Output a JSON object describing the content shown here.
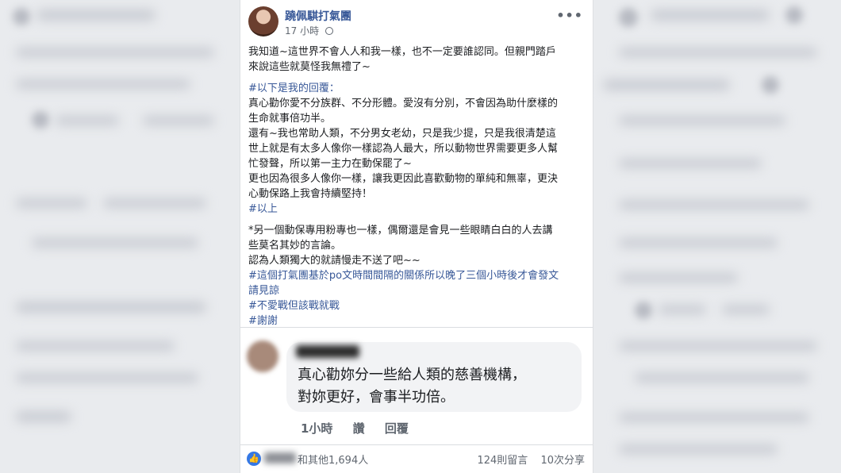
{
  "post": {
    "author": "蹺佩騏打氣團",
    "timestamp": "17 小時",
    "more_label": "•••",
    "paragraph1": [
      "我知道~這世界不會人人和我一樣，也不一定要誰認同。但親門踏戶",
      "來說這些就莫怪我無禮了~"
    ],
    "hashtag_reply": "#以下是我的回覆：",
    "reply_lines": [
      "真心勸你愛不分族群、不分形體。愛沒有分別，不會因為助什麼樣的",
      "生命就事倍功半。",
      "還有~我也常助人類，不分男女老幼，只是我少提，只是我很清楚這",
      "世上就是有太多人像你一樣認為人最大，所以動物世界需要更多人幫",
      "忙發聲，所以第一主力在動保罷了~",
      "更也因為很多人像你一樣，讓我更因此喜歡動物的單純和無辜，更決",
      "心動保路上我會持續堅持！"
    ],
    "hashtag_end": "#以上",
    "note_lines": [
      "*另一個動保專用粉專也一樣，偶爾還是會見一些眼睛白白的人去講",
      "些莫名其妙的言論。",
      "認為人類獨大的就請慢走不送了吧~~"
    ],
    "hashtags_tail": [
      "#這個打氣團基於po文時間間隔的關係所以晚了三個小時後才會發文",
      "請見諒",
      "#不愛戰但該戰就戰",
      "#謝謝"
    ]
  },
  "comment": {
    "text_lines": [
      "真心勸妳分一些給人類的慈善機構，",
      "對妳更好，會事半功倍。"
    ],
    "time": "1小時",
    "like_label": "讚",
    "reply_label": "回覆"
  },
  "footer": {
    "reaction_icon": "like-icon",
    "reactions": "和其他1,694人",
    "comments": "124則留言",
    "shares": "10次分享"
  },
  "colors": {
    "link": "#385898",
    "like_blue": "#3578e5",
    "text": "#1c1e21",
    "muted": "#606770"
  }
}
